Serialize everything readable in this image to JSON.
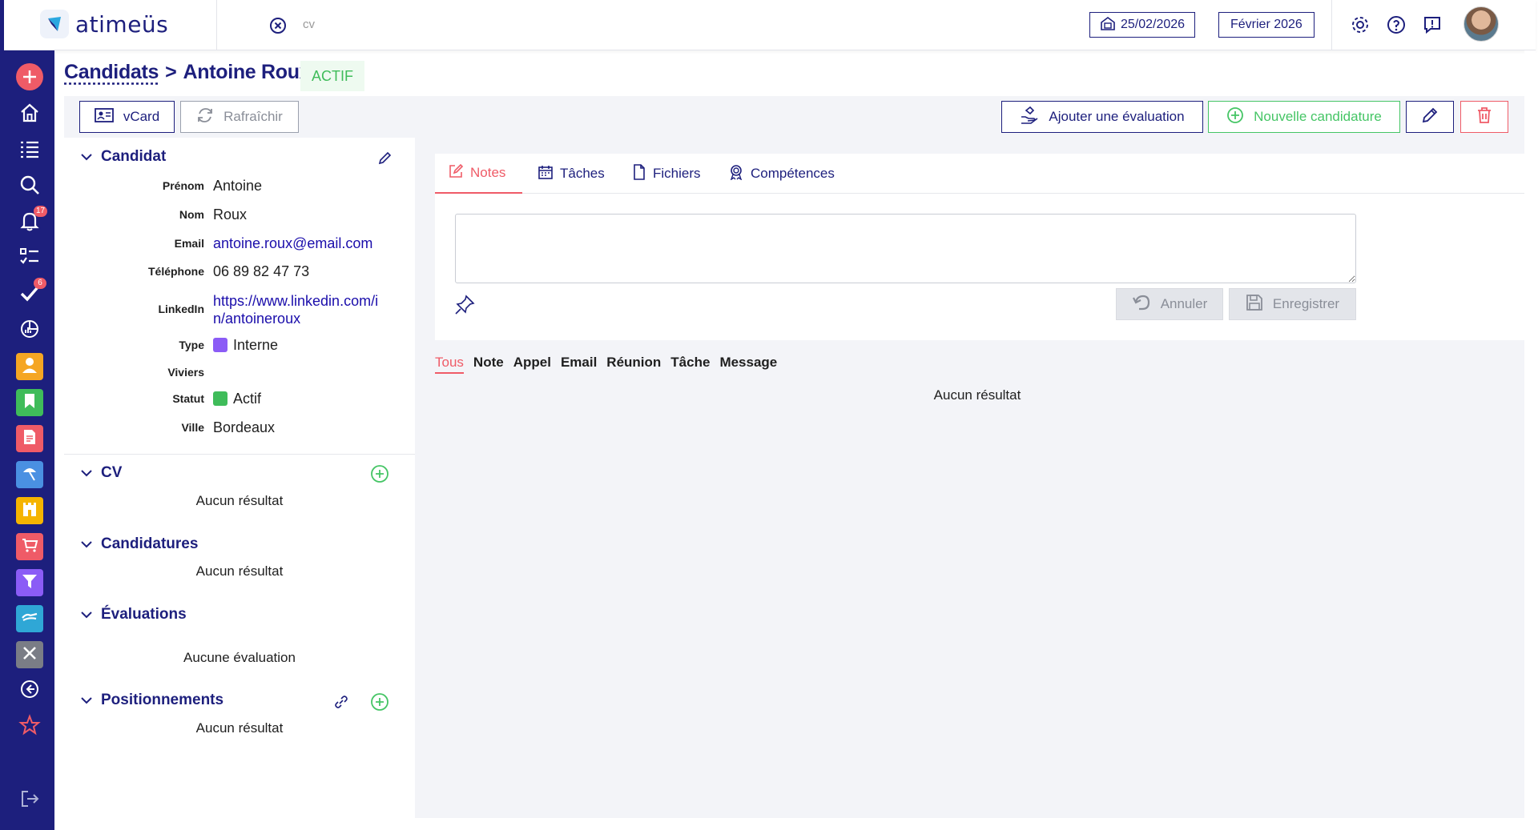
{
  "app": {
    "name": "atimeüs"
  },
  "topbar": {
    "search_text": "cv",
    "date": "25/02/2026",
    "month": "Février 2026",
    "icons": [
      "gear-icon",
      "help-icon",
      "feedback-icon"
    ]
  },
  "sidebar": {
    "items": [
      {
        "icon": "plus-icon"
      },
      {
        "icon": "home-icon"
      },
      {
        "icon": "list-icon"
      },
      {
        "icon": "search-icon"
      },
      {
        "icon": "bell-icon",
        "badge": "17"
      },
      {
        "icon": "checklist-icon"
      },
      {
        "icon": "check-icon",
        "badge": "6"
      },
      {
        "icon": "chart-icon"
      },
      {
        "icon": "person-icon",
        "color": "#f5a623"
      },
      {
        "icon": "bookmark-icon",
        "color": "#3fbc5a"
      },
      {
        "icon": "document-icon",
        "color": "#ef5b67"
      },
      {
        "icon": "beach-icon",
        "color": "#4a90e2"
      },
      {
        "icon": "castle-icon",
        "color": "#f5b400"
      },
      {
        "icon": "cart-icon",
        "color": "#ef5b67"
      },
      {
        "icon": "funnel-icon",
        "color": "#8b5cf6"
      },
      {
        "icon": "handshake-icon",
        "color": "#2fa7d6"
      },
      {
        "icon": "tools-icon",
        "color": "#7a7d86"
      },
      {
        "icon": "back-icon"
      },
      {
        "icon": "star-icon"
      },
      {
        "icon": "logout-icon"
      }
    ]
  },
  "breadcrumb": {
    "parent": "Candidats",
    "separator": ">",
    "current": "Antoine Roux"
  },
  "status_pill": "ACTIF",
  "actions": {
    "vcard": "vCard",
    "refresh": "Rafraîchir",
    "add_evaluation": "Ajouter une évaluation",
    "new_application": "Nouvelle candidature"
  },
  "candidate": {
    "section_title": "Candidat",
    "fields": {
      "firstname": {
        "label": "Prénom",
        "value": "Antoine"
      },
      "lastname": {
        "label": "Nom",
        "value": "Roux"
      },
      "email": {
        "label": "Email",
        "value": "antoine.roux@email.com"
      },
      "phone": {
        "label": "Téléphone",
        "value": "06 89 82 47 73"
      },
      "linkedin": {
        "label": "LinkedIn",
        "value_line1": "https://www.linkedin.com/i",
        "value_line2": "n/antoineroux"
      },
      "type": {
        "label": "Type",
        "value": "Interne",
        "color": "#8b5cf6"
      },
      "pools": {
        "label": "Viviers",
        "value": ""
      },
      "status": {
        "label": "Statut",
        "value": "Actif",
        "color": "#3fbc5a"
      },
      "city": {
        "label": "Ville",
        "value": "Bordeaux"
      }
    }
  },
  "sections": {
    "cv": {
      "title": "CV",
      "empty": "Aucun résultat"
    },
    "applications": {
      "title": "Candidatures",
      "empty": "Aucun résultat"
    },
    "evaluations": {
      "title": "Évaluations",
      "empty": "Aucune évaluation"
    },
    "positionings": {
      "title": "Positionnements",
      "empty": "Aucun résultat"
    }
  },
  "tabs": [
    {
      "label": "Notes",
      "icon": "edit-icon",
      "active": true
    },
    {
      "label": "Tâches",
      "icon": "calendar-icon"
    },
    {
      "label": "Fichiers",
      "icon": "file-icon"
    },
    {
      "label": "Compétences",
      "icon": "award-icon"
    }
  ],
  "notes_editor": {
    "value": "",
    "cancel": "Annuler",
    "save": "Enregistrer"
  },
  "filters": [
    "Tous",
    "Note",
    "Appel",
    "Email",
    "Réunion",
    "Tâche",
    "Message"
  ],
  "active_filter": "Tous",
  "main_empty": "Aucun résultat",
  "colors": {
    "brand": "#1d1f7d",
    "accent": "#ef5b67",
    "success": "#3fbc5a"
  }
}
